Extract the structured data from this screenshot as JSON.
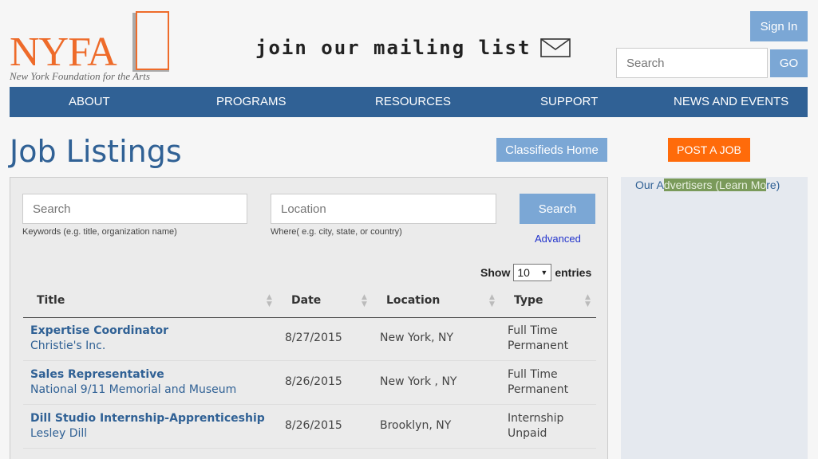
{
  "header": {
    "logo_text": "NYFA",
    "logo_subtitle": "New York Foundation for the Arts",
    "mailing_text": "join our mailing list",
    "signin_label": "Sign In",
    "search_placeholder": "Search",
    "go_label": "GO"
  },
  "nav": {
    "items": [
      "ABOUT",
      "PROGRAMS",
      "RESOURCES",
      "SUPPORT",
      "NEWS AND EVENTS"
    ]
  },
  "page": {
    "title": "Job Listings",
    "classifieds_home": "Classifieds Home",
    "post_job": "POST A JOB"
  },
  "filters": {
    "keywords_placeholder": "Search",
    "keywords_hint": "Keywords (e.g. title, organization name)",
    "location_placeholder": "Location",
    "location_hint": "Where( e.g. city, state, or country)",
    "search_label": "Search",
    "advanced_label": "Advanced"
  },
  "table": {
    "show_label": "Show",
    "show_value": "10",
    "entries_label": "entries",
    "columns": [
      "Title",
      "Date",
      "Location",
      "Type"
    ],
    "rows": [
      {
        "title": "Expertise Coordinator",
        "org": "Christie's Inc.",
        "date": "8/27/2015",
        "location": "New York, NY",
        "type1": "Full Time",
        "type2": "Permanent"
      },
      {
        "title": "Sales Representative",
        "org": "National 9/11 Memorial and Museum",
        "date": "8/26/2015",
        "location": "New York , NY",
        "type1": "Full Time",
        "type2": "Permanent"
      },
      {
        "title": "Dill Studio Internship-Apprenticeship",
        "org": "Lesley Dill",
        "date": "8/26/2015",
        "location": "Brooklyn, NY",
        "type1": "Internship",
        "type2": "Unpaid"
      }
    ]
  },
  "sidebar": {
    "link_pre": "Our A",
    "link_hl": "dvertisers (Learn Mo",
    "link_post": "re)"
  },
  "colors": {
    "brand_orange": "#ee6b2a",
    "nav_blue": "#306195",
    "button_blue": "#7ba7d5",
    "post_orange": "#ff6b0a"
  }
}
